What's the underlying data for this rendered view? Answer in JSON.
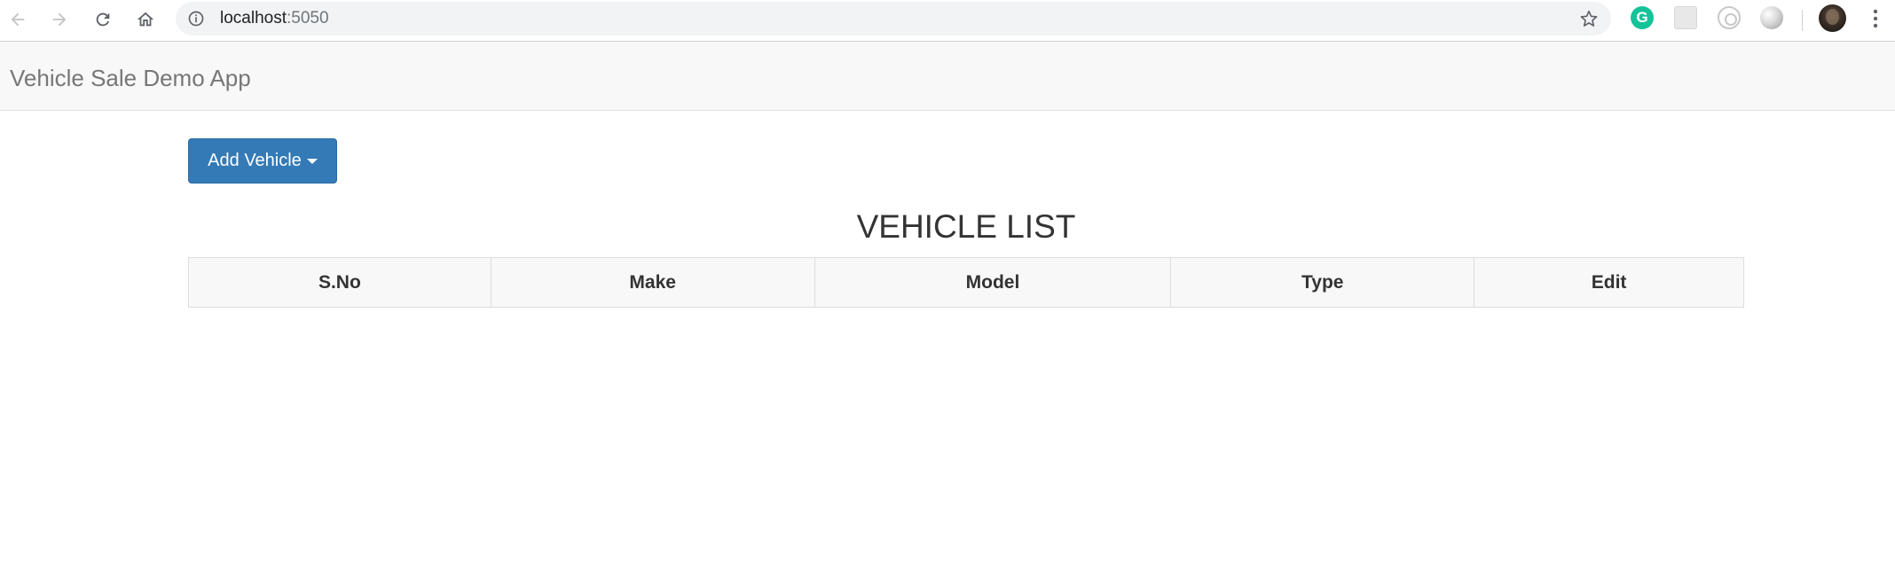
{
  "browser": {
    "url_host": "localhost",
    "url_port": ":5050",
    "extensions": {
      "grammarly_letter": "G"
    }
  },
  "navbar": {
    "brand": "Vehicle Sale Demo App"
  },
  "main": {
    "add_button_label": "Add Vehicle",
    "title": "VEHICLE LIST",
    "table": {
      "columns": [
        "S.No",
        "Make",
        "Model",
        "Type",
        "Edit"
      ],
      "rows": []
    }
  },
  "colors": {
    "primary": "#337ab7",
    "navbar_bg": "#f8f8f8",
    "brand_text": "#777777"
  }
}
